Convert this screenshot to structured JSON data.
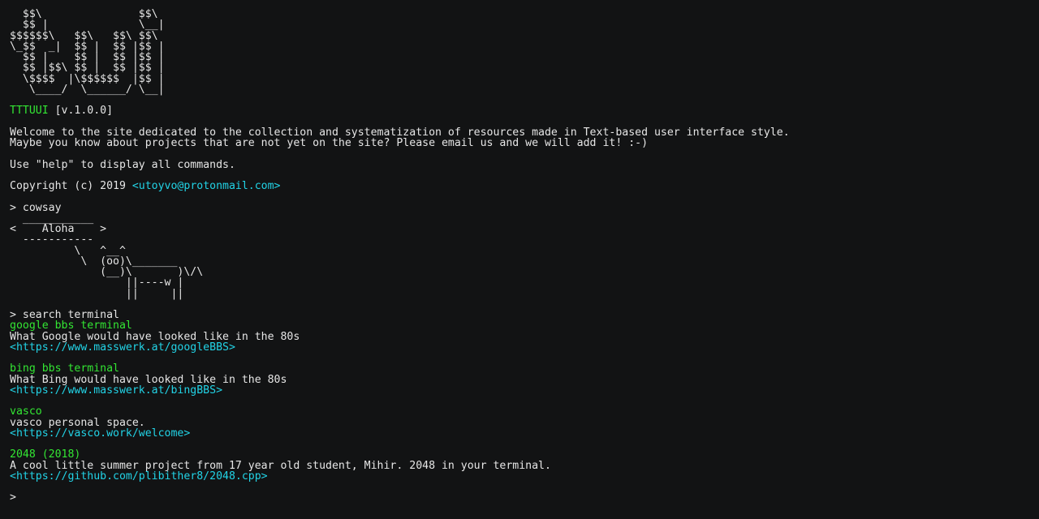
{
  "logo": {
    "ascii": "  $$\\               $$\\\n  $$ |              \\__|\n$$$$$$\\   $$\\   $$\\ $$\\\n\\_$$  _|  $$ |  $$ |$$ |\n  $$ |    $$ |  $$ |$$ |\n  $$ |$$\\ $$ |  $$ |$$ |\n  \\$$$$  |\\$$$$$$  |$$ |\n   \\____/  \\______/ \\__|"
  },
  "header": {
    "name": "TTTUUI",
    "version": " [v.1.0.0]"
  },
  "intro": {
    "line1": "Welcome to the site dedicated to the collection and systematization of resources made in Text-based user interface style.",
    "line2": "Maybe you know about projects that are not yet on the site? Please email us and we will add it! :-)",
    "help": "Use \"help\" to display all commands.",
    "copyright_prefix": "Copyright (c) 2019 ",
    "copyright_email": "<utoyvo@protonmail.com>"
  },
  "commands": {
    "cowsay_prompt": "> cowsay",
    "cowsay_output": "  ___________\n<    Aloha    >\n  -----------\n          \\   ^__^\n           \\  (oo)\\_______\n              (__)\\       )\\/\\\n                  ||----w |\n                  ||     ||",
    "search_prompt": "> search terminal"
  },
  "results": [
    {
      "title": "google bbs terminal",
      "description": "What Google would have looked like in the 80s",
      "link": "<https://www.masswerk.at/googleBBS>"
    },
    {
      "title": "bing bbs terminal",
      "description": "What Bing would have looked like in the 80s",
      "link": "<https://www.masswerk.at/bingBBS>"
    },
    {
      "title": "vasco",
      "description": "vasco personal space.",
      "link": "<https://vasco.work/welcome>"
    },
    {
      "title": "2048 (2018)",
      "description": "A cool little summer project from 17 year old student, Mihir. 2048 in your terminal.",
      "link": "<https://github.com/plibither8/2048.cpp>"
    }
  ],
  "input": {
    "prompt": ">",
    "value": ""
  },
  "colors": {
    "background": "#121314",
    "text": "#e6e6e6",
    "accent_green": "#33e633",
    "accent_cyan": "#22d3e6"
  }
}
